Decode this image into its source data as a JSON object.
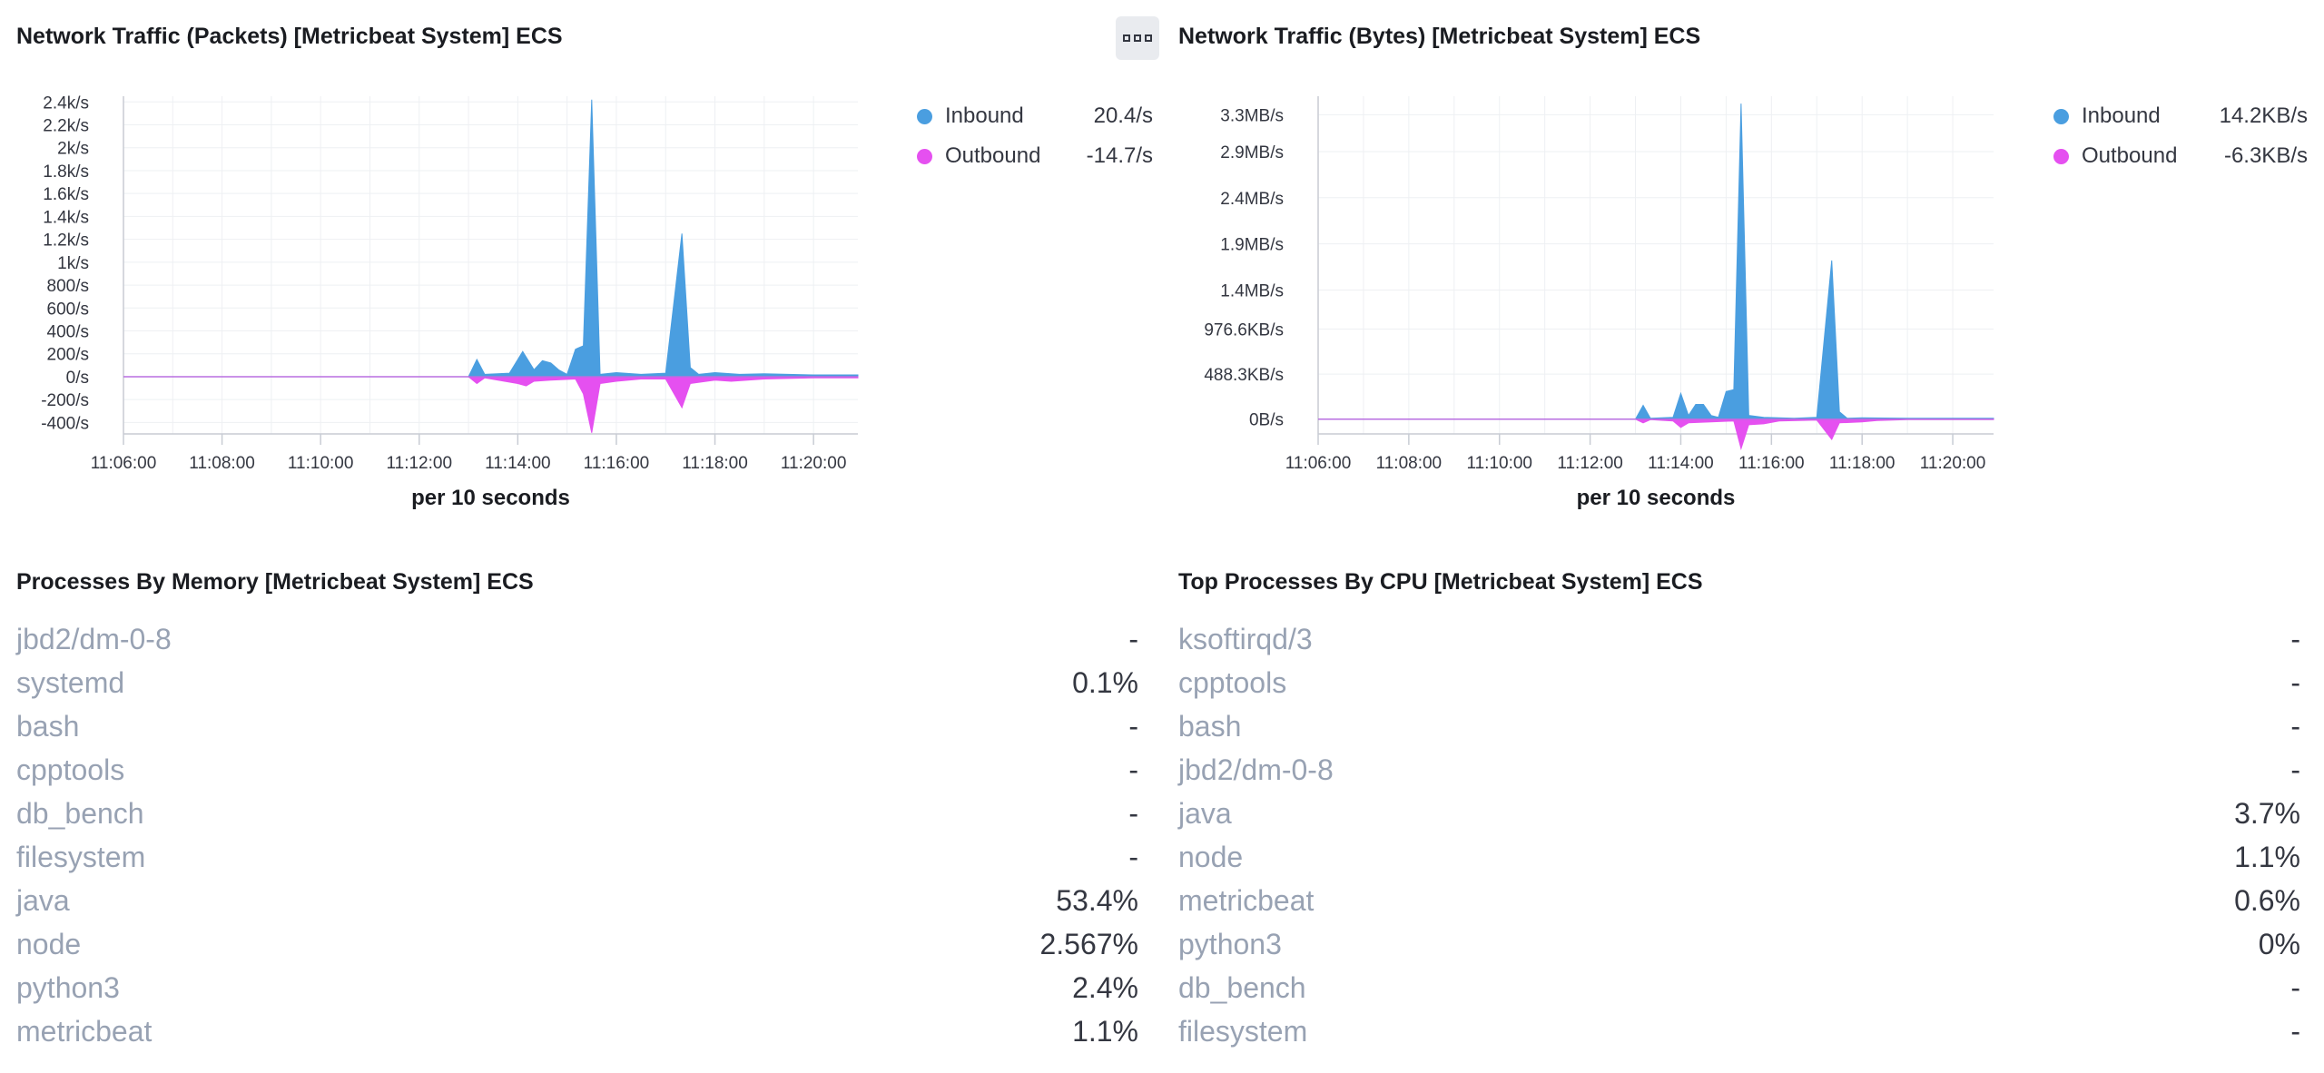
{
  "panels": {
    "packets": {
      "title": "Network Traffic (Packets) [Metricbeat System] ECS",
      "y_ticks": [
        "2.4k/s",
        "2.2k/s",
        "2k/s",
        "1.8k/s",
        "1.6k/s",
        "1.4k/s",
        "1.2k/s",
        "1k/s",
        "800/s",
        "600/s",
        "400/s",
        "200/s",
        "0/s",
        "-200/s",
        "-400/s"
      ],
      "x_ticks": [
        "11:06:00",
        "11:08:00",
        "11:10:00",
        "11:12:00",
        "11:14:00",
        "11:16:00",
        "11:18:00",
        "11:20:00"
      ],
      "x_label": "per 10 seconds",
      "legend": [
        {
          "name": "Inbound",
          "value": "20.4/s",
          "color": "#4a9ee0"
        },
        {
          "name": "Outbound",
          "value": "-14.7/s",
          "color": "#e550f0"
        }
      ]
    },
    "bytes": {
      "title": "Network Traffic (Bytes) [Metricbeat System] ECS",
      "y_ticks": [
        "3.3MB/s",
        "2.9MB/s",
        "2.4MB/s",
        "1.9MB/s",
        "1.4MB/s",
        "976.6KB/s",
        "488.3KB/s",
        "0B/s"
      ],
      "x_ticks": [
        "11:06:00",
        "11:08:00",
        "11:10:00",
        "11:12:00",
        "11:14:00",
        "11:16:00",
        "11:18:00",
        "11:20:00"
      ],
      "x_label": "per 10 seconds",
      "legend": [
        {
          "name": "Inbound",
          "value": "14.2KB/s",
          "color": "#4a9ee0"
        },
        {
          "name": "Outbound",
          "value": "-6.3KB/s",
          "color": "#e550f0"
        }
      ]
    },
    "memory": {
      "title": "Processes By Memory [Metricbeat System] ECS",
      "rows": [
        {
          "name": "jbd2/dm-0-8",
          "value": "-"
        },
        {
          "name": "systemd",
          "value": "0.1%"
        },
        {
          "name": "bash",
          "value": "-"
        },
        {
          "name": "cpptools",
          "value": "-"
        },
        {
          "name": "db_bench",
          "value": "-"
        },
        {
          "name": "filesystem",
          "value": "-"
        },
        {
          "name": "java",
          "value": "53.4%"
        },
        {
          "name": "node",
          "value": "2.567%"
        },
        {
          "name": "python3",
          "value": "2.4%"
        },
        {
          "name": "metricbeat",
          "value": "1.1%"
        }
      ]
    },
    "cpu": {
      "title": "Top Processes By CPU [Metricbeat System] ECS",
      "rows": [
        {
          "name": "ksoftirqd/3",
          "value": "-"
        },
        {
          "name": "cpptools",
          "value": "-"
        },
        {
          "name": "bash",
          "value": "-"
        },
        {
          "name": "jbd2/dm-0-8",
          "value": "-"
        },
        {
          "name": "java",
          "value": "3.7%"
        },
        {
          "name": "node",
          "value": "1.1%"
        },
        {
          "name": "metricbeat",
          "value": "0.6%"
        },
        {
          "name": "python3",
          "value": "0%"
        },
        {
          "name": "db_bench",
          "value": "-"
        },
        {
          "name": "filesystem",
          "value": "-"
        }
      ]
    }
  },
  "chart_data": [
    {
      "type": "area",
      "title": "Network Traffic (Packets) [Metricbeat System] ECS",
      "xlabel": "per 10 seconds",
      "ylabel": "",
      "x_unit": "minutes after 11:06:00",
      "ylim": [
        -500,
        2450
      ],
      "series": [
        {
          "name": "Inbound",
          "color": "#4a9ee0",
          "points": [
            [
              0,
              0
            ],
            [
              7,
              0
            ],
            [
              7.17,
              150
            ],
            [
              7.33,
              20
            ],
            [
              7.83,
              30
            ],
            [
              8.1,
              220
            ],
            [
              8.33,
              60
            ],
            [
              8.5,
              140
            ],
            [
              8.67,
              120
            ],
            [
              8.83,
              60
            ],
            [
              9.0,
              20
            ],
            [
              9.17,
              240
            ],
            [
              9.33,
              270
            ],
            [
              9.5,
              2420
            ],
            [
              9.67,
              20
            ],
            [
              10.0,
              35
            ],
            [
              10.5,
              20
            ],
            [
              11.0,
              30
            ],
            [
              11.33,
              1250
            ],
            [
              11.5,
              80
            ],
            [
              11.67,
              20
            ],
            [
              12.0,
              35
            ],
            [
              12.5,
              20
            ],
            [
              13.0,
              25
            ],
            [
              14.0,
              15
            ],
            [
              14.9,
              15
            ]
          ]
        },
        {
          "name": "Outbound",
          "color": "#e550f0",
          "points": [
            [
              0,
              0
            ],
            [
              7,
              0
            ],
            [
              7.17,
              -60
            ],
            [
              7.33,
              -10
            ],
            [
              8.0,
              -60
            ],
            [
              8.17,
              -80
            ],
            [
              8.33,
              -40
            ],
            [
              8.67,
              -30
            ],
            [
              9.17,
              -20
            ],
            [
              9.33,
              -150
            ],
            [
              9.5,
              -490
            ],
            [
              9.67,
              -60
            ],
            [
              10.0,
              -40
            ],
            [
              10.5,
              -20
            ],
            [
              11.0,
              -20
            ],
            [
              11.33,
              -270
            ],
            [
              11.5,
              -60
            ],
            [
              12.0,
              -30
            ],
            [
              12.33,
              -40
            ],
            [
              13.0,
              -20
            ],
            [
              14.0,
              -10
            ],
            [
              14.9,
              -10
            ]
          ]
        }
      ]
    },
    {
      "type": "area",
      "title": "Network Traffic (Bytes) [Metricbeat System] ECS",
      "xlabel": "per 10 seconds",
      "ylabel": "",
      "x_unit": "minutes after 11:06:00",
      "ylim": [
        -160000,
        3500000
      ],
      "series": [
        {
          "name": "Inbound",
          "color": "#4a9ee0",
          "points": [
            [
              0,
              0
            ],
            [
              7,
              0
            ],
            [
              7.17,
              150000
            ],
            [
              7.33,
              10000
            ],
            [
              7.83,
              20000
            ],
            [
              8.0,
              280000
            ],
            [
              8.17,
              40000
            ],
            [
              8.33,
              160000
            ],
            [
              8.5,
              160000
            ],
            [
              8.67,
              40000
            ],
            [
              8.83,
              20000
            ],
            [
              9.0,
              300000
            ],
            [
              9.17,
              320000
            ],
            [
              9.33,
              3420000
            ],
            [
              9.5,
              40000
            ],
            [
              9.83,
              20000
            ],
            [
              10.5,
              10000
            ],
            [
              11.0,
              20000
            ],
            [
              11.33,
              1720000
            ],
            [
              11.5,
              80000
            ],
            [
              11.67,
              10000
            ],
            [
              12.0,
              15000
            ],
            [
              13.0,
              10000
            ],
            [
              14.9,
              10000
            ]
          ]
        },
        {
          "name": "Outbound",
          "color": "#e550f0",
          "points": [
            [
              0,
              0
            ],
            [
              7,
              0
            ],
            [
              7.17,
              -40000
            ],
            [
              7.33,
              -5000
            ],
            [
              7.83,
              -20000
            ],
            [
              8.0,
              -90000
            ],
            [
              8.17,
              -40000
            ],
            [
              8.67,
              -30000
            ],
            [
              9.17,
              -20000
            ],
            [
              9.33,
              -320000
            ],
            [
              9.5,
              -60000
            ],
            [
              9.83,
              -50000
            ],
            [
              10.17,
              -20000
            ],
            [
              11.0,
              -10000
            ],
            [
              11.33,
              -220000
            ],
            [
              11.5,
              -40000
            ],
            [
              12.0,
              -30000
            ],
            [
              12.33,
              -15000
            ],
            [
              13.0,
              -5000
            ],
            [
              14.9,
              -5000
            ]
          ]
        }
      ]
    }
  ]
}
